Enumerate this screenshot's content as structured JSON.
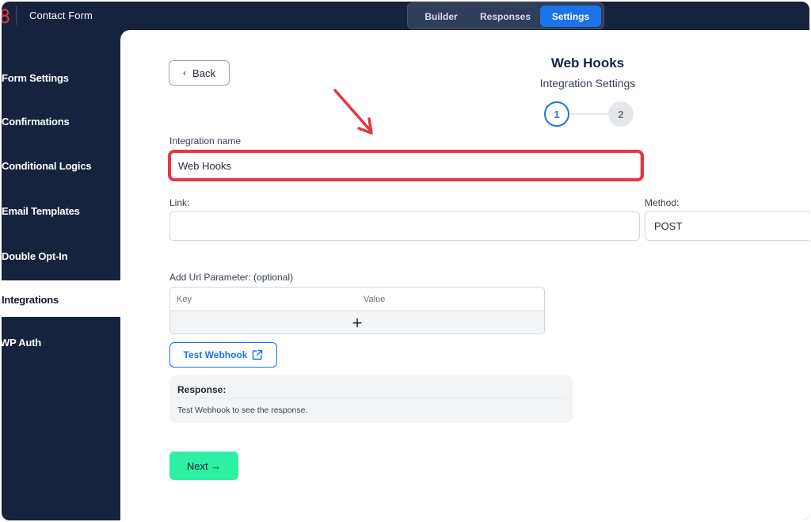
{
  "app": {
    "title": "Contact Form"
  },
  "tabs": [
    {
      "label": "Builder"
    },
    {
      "label": "Responses"
    },
    {
      "label": "Settings"
    }
  ],
  "sidebar": {
    "items": [
      {
        "label": "Form Settings"
      },
      {
        "label": "Confirmations"
      },
      {
        "label": "Conditional Logics"
      },
      {
        "label": "Email Templates"
      },
      {
        "label": "Double Opt-In"
      },
      {
        "label": "Integrations"
      },
      {
        "label": "WP Auth"
      }
    ],
    "active_index": 5
  },
  "main": {
    "back_label": "Back",
    "title": "Web Hooks",
    "subtitle": "Integration Settings",
    "steps": [
      "1",
      "2"
    ],
    "integration_name_label": "Integration name",
    "integration_name_value": "Web Hooks",
    "link_label": "Link:",
    "link_value": "",
    "method_label": "Method:",
    "method_value": "POST",
    "url_params_label": "Add Url Parameter: (optional)",
    "params_headers": {
      "key": "Key",
      "value": "Value"
    },
    "add_symbol": "+",
    "test_webhook_label": "Test Webhook",
    "response_title": "Response:",
    "response_text": "Test Webhook to see the response.",
    "next_label": "Next →"
  },
  "colors": {
    "dark_navy": "#15233f",
    "accent_blue": "#1a73e8",
    "highlight_red": "#e53542",
    "next_green": "#2df0a3"
  },
  "icons": [
    "logo-icon",
    "chevron-left-icon",
    "plus-icon",
    "external-link-icon",
    "annotation-arrow-icon"
  ]
}
